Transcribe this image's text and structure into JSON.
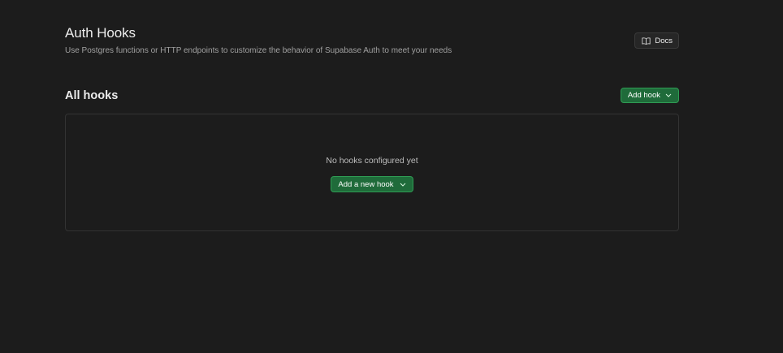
{
  "header": {
    "title": "Auth Hooks",
    "subtitle": "Use Postgres functions or HTTP endpoints to customize the behavior of Supabase Auth to meet your needs",
    "docs_label": "Docs",
    "docs_icon": "book-icon"
  },
  "section": {
    "title": "All hooks",
    "add_hook_label": "Add hook",
    "add_hook_icon": "chevron-down-icon"
  },
  "empty_state": {
    "message": "No hooks configured yet",
    "button_label": "Add a new hook",
    "button_icon": "chevron-down-icon"
  },
  "colors": {
    "background": "#1c1c1c",
    "brand_green": "#1f6b3a",
    "brand_green_border": "#2f9c54",
    "border": "#333333",
    "text_primary": "#ededed",
    "text_secondary": "#a0a0a0"
  }
}
